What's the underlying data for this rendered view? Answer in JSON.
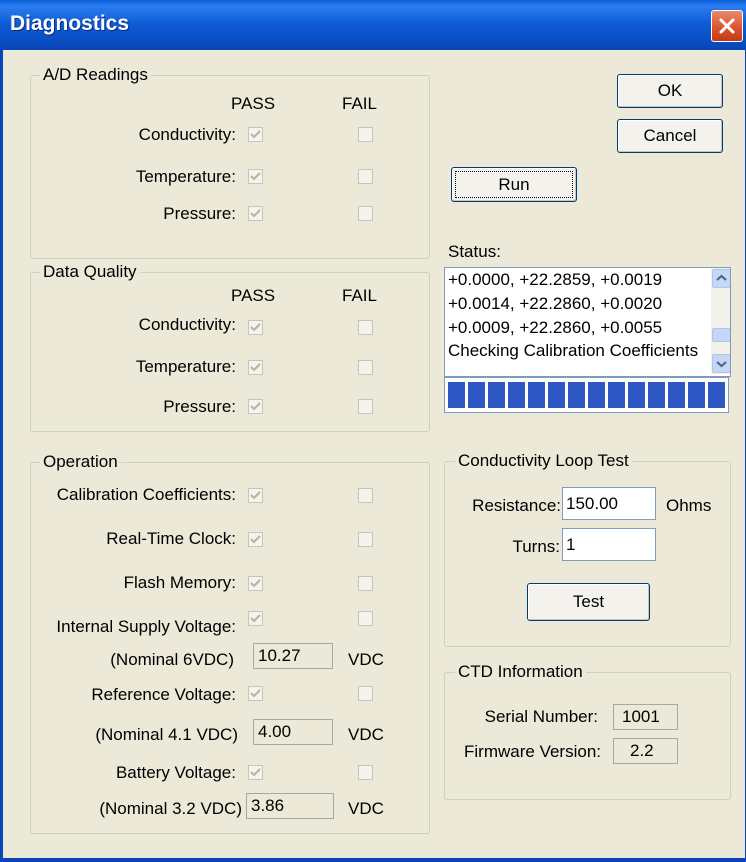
{
  "window": {
    "title": "Diagnostics"
  },
  "buttons": {
    "ok": "OK",
    "cancel": "Cancel",
    "run": "Run",
    "test": "Test"
  },
  "ad_readings": {
    "label": "A/D Readings",
    "pass_header": "PASS",
    "fail_header": "FAIL",
    "rows": [
      {
        "label": "Conductivity:",
        "pass": true,
        "fail": false
      },
      {
        "label": "Temperature:",
        "pass": true,
        "fail": false
      },
      {
        "label": "Pressure:",
        "pass": true,
        "fail": false
      }
    ]
  },
  "data_quality": {
    "label": "Data Quality",
    "pass_header": "PASS",
    "fail_header": "FAIL",
    "rows": [
      {
        "label": "Conductivity:",
        "pass": true,
        "fail": false
      },
      {
        "label": "Temperature:",
        "pass": true,
        "fail": false
      },
      {
        "label": "Pressure:",
        "pass": true,
        "fail": false
      }
    ]
  },
  "operation": {
    "label": "Operation",
    "rows": [
      {
        "label": "Calibration Coefficients:",
        "pass": true,
        "fail": false
      },
      {
        "label": "Real-Time Clock:",
        "pass": true,
        "fail": false
      },
      {
        "label": "Flash Memory:",
        "pass": true,
        "fail": false
      },
      {
        "label": "Internal Supply Voltage:",
        "pass": true,
        "fail": false
      },
      {
        "label": "Reference Voltage:",
        "pass": true,
        "fail": false
      },
      {
        "label": "Battery Voltage:",
        "pass": true,
        "fail": false
      }
    ],
    "voltages": [
      {
        "nominal": "(Nominal 6VDC)",
        "value": "10.27",
        "unit": "VDC"
      },
      {
        "nominal": "(Nominal 4.1 VDC)",
        "value": "4.00",
        "unit": "VDC"
      },
      {
        "nominal": "(Nominal 3.2 VDC)",
        "value": "3.86",
        "unit": "VDC"
      }
    ]
  },
  "status": {
    "label": "Status:",
    "lines": [
      "+0.0000, +22.2859, +0.0019",
      "+0.0014, +22.2860, +0.0020",
      "+0.0009, +22.2860, +0.0055",
      "Checking Calibration Coefficients"
    ],
    "progress_segments_filled": 14,
    "progress_color": "#2d57c2"
  },
  "conductivity_loop": {
    "label": "Conductivity Loop Test",
    "resistance_label": "Resistance:",
    "resistance_value": "150.00",
    "resistance_unit": "Ohms",
    "turns_label": "Turns:",
    "turns_value": "1"
  },
  "ctd_info": {
    "label": "CTD Information",
    "serial_label": "Serial Number:",
    "serial_value": "1001",
    "firmware_label": "Firmware Version:",
    "firmware_value": "2.2"
  },
  "icons": {
    "close": "close-icon",
    "scroll_up": "chevron-up-icon",
    "scroll_down": "chevron-down-icon",
    "check": "check-icon"
  }
}
